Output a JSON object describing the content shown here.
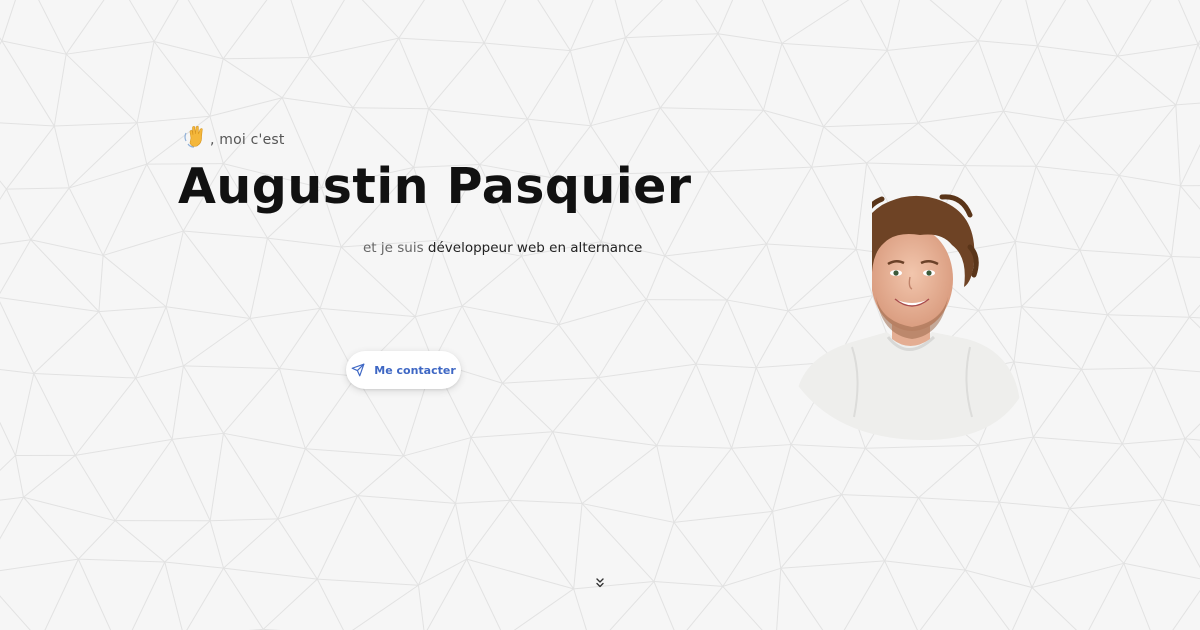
{
  "hero": {
    "greeting_emoji": "wave-icon",
    "greeting_text": ", moi c'est",
    "name": "Augustin Pasquier",
    "subtitle_prefix": "et je suis ",
    "subtitle_role": "développeur web en alternance"
  },
  "contact_button": {
    "label": "Me contacter",
    "icon": "send-icon",
    "color": "#3e67c4"
  },
  "portrait": {
    "alt": "portrait"
  },
  "scroll_indicator": {
    "icon": "chevrons-down-icon"
  }
}
